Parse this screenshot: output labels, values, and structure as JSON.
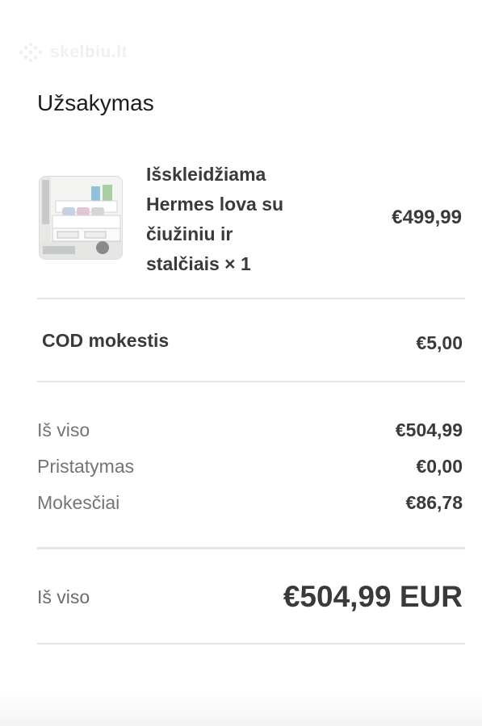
{
  "watermark": {
    "text": "skelbiu.lt",
    "icon": "dots-logo-icon"
  },
  "order": {
    "title": "Užsakymas",
    "item": {
      "name_lines": [
        "Išskleidžiama",
        "Hermes lova su",
        "čiužiniu ir",
        "stalčiais × 1"
      ],
      "price": "€499,99",
      "image": "bed-thumbnail-image"
    },
    "cod": {
      "label": "COD mokestis",
      "value": "€5,00"
    },
    "summary": [
      {
        "label": "Iš viso",
        "value": "€504,99"
      },
      {
        "label": "Pristatymas",
        "value": "€0,00"
      },
      {
        "label": "Mokesčiai",
        "value": "€86,78"
      }
    ],
    "total": {
      "label": "Iš viso",
      "value": "€504,99 EUR"
    }
  },
  "colors": {
    "text_primary": "#3a3a3a",
    "text_secondary": "#747474",
    "divider": "#e4e4e4"
  }
}
